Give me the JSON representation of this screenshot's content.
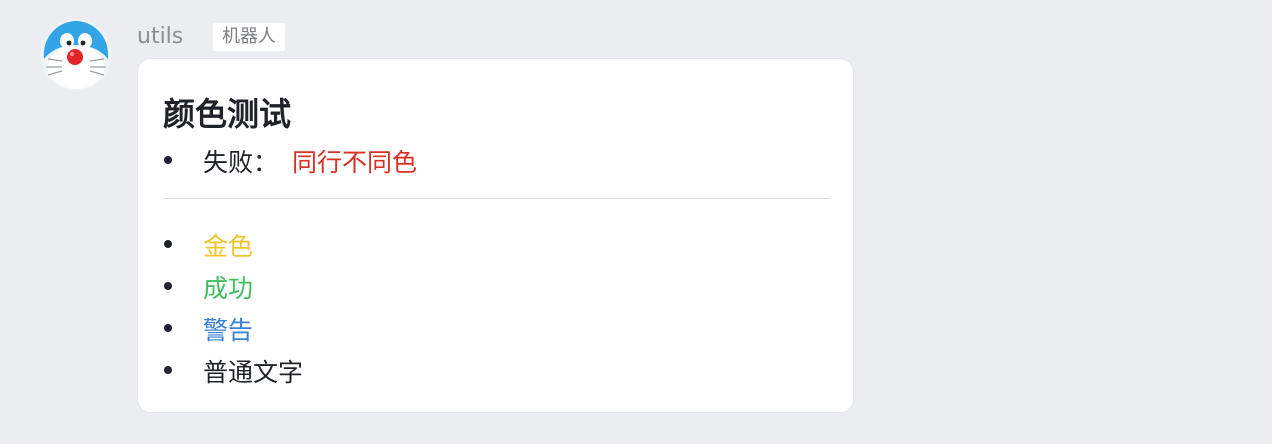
{
  "message": {
    "sender": "utils",
    "bot_tag": "机器人"
  },
  "card": {
    "title": "颜色测试",
    "section1": [
      {
        "label": "失败：",
        "value": "同行不同色",
        "value_color": "#d93026"
      }
    ],
    "section2": [
      {
        "text": "金色",
        "color": "#f0c52b"
      },
      {
        "text": "成功",
        "color": "#3fbf5f"
      },
      {
        "text": "警告",
        "color": "#3b82d6"
      },
      {
        "text": "普通文字",
        "color": "#1f2329"
      }
    ]
  },
  "colors": {
    "background": "#ebedf0",
    "card": "#ffffff",
    "text": "#1f2329"
  },
  "icons": {
    "avatar": "robot-mascot-avatar",
    "list_marker": "bullet-dot"
  }
}
